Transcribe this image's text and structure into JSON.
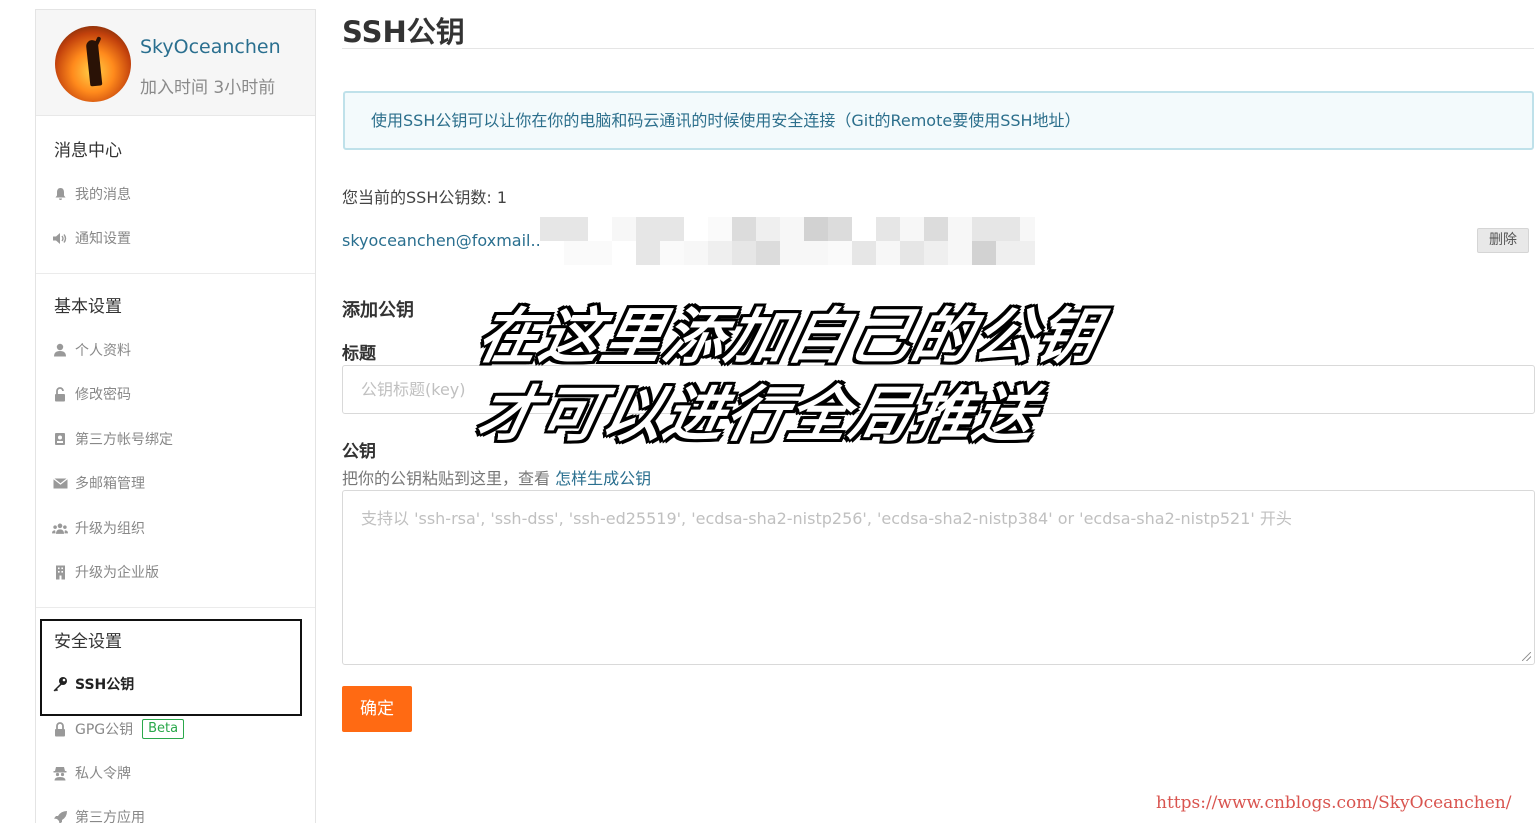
{
  "profile": {
    "username": "SkyOceanchen",
    "joined": "加入时间 3小时前"
  },
  "sidebar": {
    "sections": [
      {
        "title": "消息中心",
        "items": [
          {
            "label": "我的消息",
            "icon": "bell-icon"
          },
          {
            "label": "通知设置",
            "icon": "volume-icon"
          }
        ]
      },
      {
        "title": "基本设置",
        "items": [
          {
            "label": "个人资料",
            "icon": "user-icon"
          },
          {
            "label": "修改密码",
            "icon": "lock-icon"
          },
          {
            "label": "第三方帐号绑定",
            "icon": "id-card-icon"
          },
          {
            "label": "多邮箱管理",
            "icon": "mail-icon"
          },
          {
            "label": "升级为组织",
            "icon": "users-icon"
          },
          {
            "label": "升级为企业版",
            "icon": "building-icon"
          }
        ]
      },
      {
        "title": "安全设置",
        "items": [
          {
            "label": "SSH公钥",
            "icon": "key-icon",
            "active": true
          },
          {
            "label": "GPG公钥",
            "icon": "lock-icon",
            "badge": "Beta"
          },
          {
            "label": "私人令牌",
            "icon": "spy-icon"
          },
          {
            "label": "第三方应用",
            "icon": "rocket-icon"
          }
        ]
      }
    ]
  },
  "main": {
    "title": "SSH公钥",
    "info": "使用SSH公钥可以让你在你的电脑和码云通讯的时候使用安全连接（Git的Remote要使用SSH地址）",
    "key_count": "您当前的SSH公钥数: 1",
    "key_label": "skyoceanchen@foxmail....",
    "delete_label": "删除",
    "add_heading": "添加公钥",
    "title_label": "标题",
    "title_placeholder": "公钥标题(key)",
    "key_field_label": "公钥",
    "helper_text": "把你的公钥粘贴到这里，查看 ",
    "helper_link": "怎样生成公钥",
    "key_placeholder": "支持以 'ssh-rsa', 'ssh-dss', 'ssh-ed25519', 'ecdsa-sha2-nistp256', 'ecdsa-sha2-nistp384' or 'ecdsa-sha2-nistp521' 开头",
    "submit_label": "确定"
  },
  "annotation": {
    "line1": "在这里添加自己的公钥",
    "line2": "才可以进行全局推送"
  },
  "watermark": "https://www.cnblogs.com/SkyOceanchen/",
  "colors": {
    "accent": "#ff6a13",
    "link": "#2a6f8f",
    "info_bg": "#f3fafc",
    "info_border": "#bfe1ea",
    "badge_green": "#2aa84a"
  }
}
